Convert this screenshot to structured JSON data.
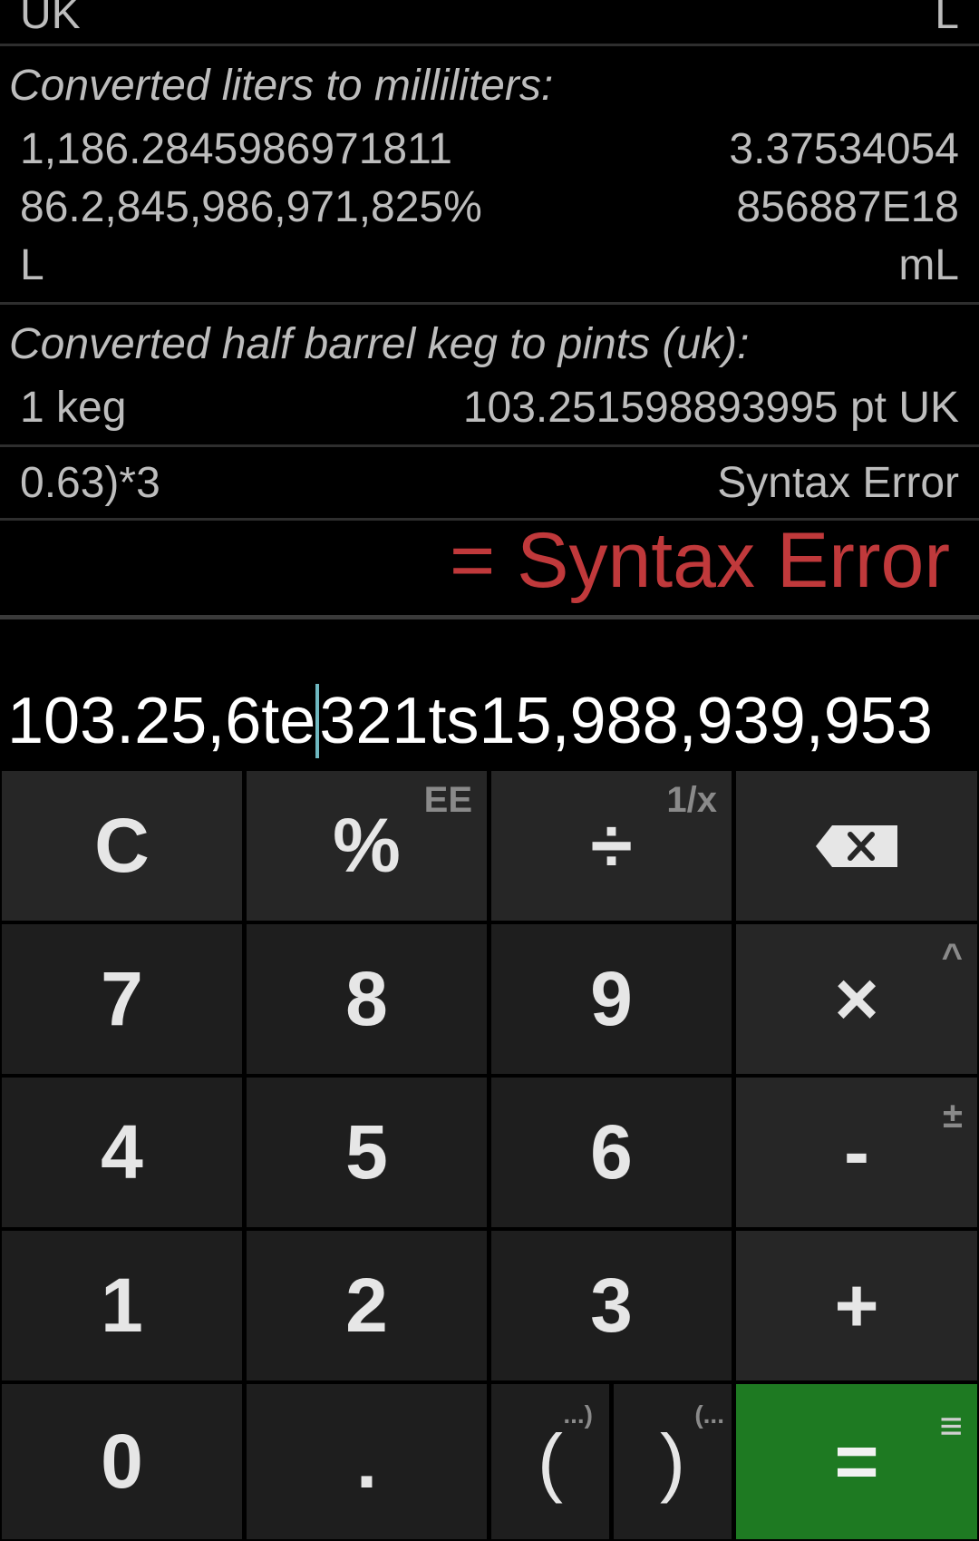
{
  "history": {
    "row0": {
      "left": "UK",
      "right": "L"
    },
    "entry1": {
      "caption": "Converted liters to milliliters:",
      "left_lines": [
        "1,186.2845986971811",
        "86.2,845,986,971,825%",
        "L"
      ],
      "right_lines": [
        "3.37534054",
        "856887E18",
        "mL"
      ]
    },
    "entry2": {
      "caption": "Converted half barrel keg to pints (uk):",
      "left": "1 keg",
      "right": "103.251598893995 pt UK"
    },
    "entry3": {
      "left": "0.63)*3",
      "right": "Syntax Error"
    }
  },
  "result": {
    "text": "= Syntax Error",
    "color": "#c0393b"
  },
  "input": {
    "before_cursor": "103.25,6te",
    "after_cursor": "321ts15,988,939,953"
  },
  "keys": {
    "clear": "C",
    "percent": "%",
    "percent_sub": "EE",
    "divide": "÷",
    "divide_sub": "1/x",
    "backspace_icon": "backspace-icon",
    "seven": "7",
    "eight": "8",
    "nine": "9",
    "multiply": "×",
    "multiply_sub": "^",
    "four": "4",
    "five": "5",
    "six": "6",
    "minus": "-",
    "minus_sub": "±",
    "one": "1",
    "two": "2",
    "three": "3",
    "plus": "+",
    "zero": "0",
    "dot": ".",
    "open_paren": "(",
    "open_paren_sub": "...)",
    "close_paren": ")",
    "close_paren_sub": "(...",
    "equals": "=",
    "equals_sub": "≡"
  },
  "colors": {
    "equals_bg": "#1e7a22",
    "caret": "#6fb8c0"
  }
}
